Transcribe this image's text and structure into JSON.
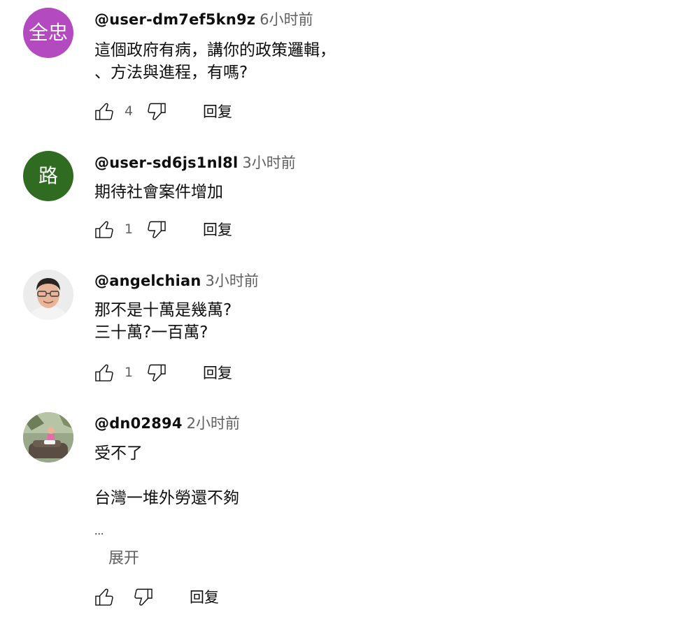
{
  "comments": [
    {
      "avatar_text": "全忠",
      "avatar_color": "#b34ac0",
      "author": "@user-dm7ef5kn9z",
      "time": "6小时前",
      "lines": [
        "這個政府有病，講你的政策邏輯，",
        "、方法與進程，有嗎?"
      ],
      "likes": "4",
      "reply_label": "回复"
    },
    {
      "avatar_text": "路",
      "avatar_color": "#2f6b21",
      "author": "@user-sd6js1nl8l",
      "time": "3小时前",
      "lines": [
        "期待社會案件增加"
      ],
      "likes": "1",
      "reply_label": "回复"
    },
    {
      "avatar_text": "",
      "author": "@angelchian",
      "time": "3小时前",
      "lines": [
        "那不是十萬是幾萬?",
        "三十萬?一百萬?"
      ],
      "likes": "1",
      "reply_label": "回复"
    },
    {
      "avatar_text": "",
      "author": "@dn02894",
      "time": "2小时前",
      "lines": [
        "受不了",
        "",
        "台灣一堆外勞還不夠"
      ],
      "ellipsis": "...",
      "expand_label": "展开",
      "likes": "",
      "reply_label": "回复"
    }
  ],
  "icons": {
    "like": "thumb-up-icon",
    "dislike": "thumb-down-icon"
  }
}
